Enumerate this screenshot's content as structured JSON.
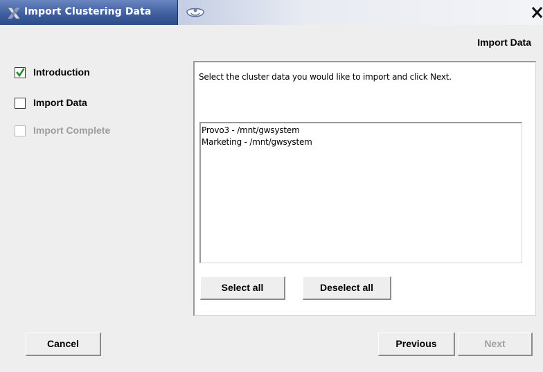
{
  "window": {
    "title": "Import Clustering Data"
  },
  "header": {
    "step_title": "Import Data"
  },
  "steps": [
    {
      "label": "Introduction",
      "checked": true,
      "enabled": true
    },
    {
      "label": "Import Data",
      "checked": false,
      "enabled": true
    },
    {
      "label": "Import Complete",
      "checked": false,
      "enabled": false
    }
  ],
  "panel": {
    "instruction": "Select the cluster data you would like to import and click Next.",
    "clusters": [
      "Provo3 - /mnt/gwsystem",
      "Marketing - /mnt/gwsystem"
    ],
    "select_all_label": "Select all",
    "deselect_all_label": "Deselect all"
  },
  "footer": {
    "cancel_label": "Cancel",
    "previous_label": "Previous",
    "next_label": "Next",
    "next_enabled": false
  },
  "icons": {
    "app": "app-x-icon",
    "rollup": "window-shade-icon",
    "close": "close-icon",
    "check": "checkmark-icon"
  },
  "colors": {
    "titlebar_active": "#3f5f9f",
    "check_green": "#1f8c1f",
    "disabled_text": "#9c9c9c"
  }
}
